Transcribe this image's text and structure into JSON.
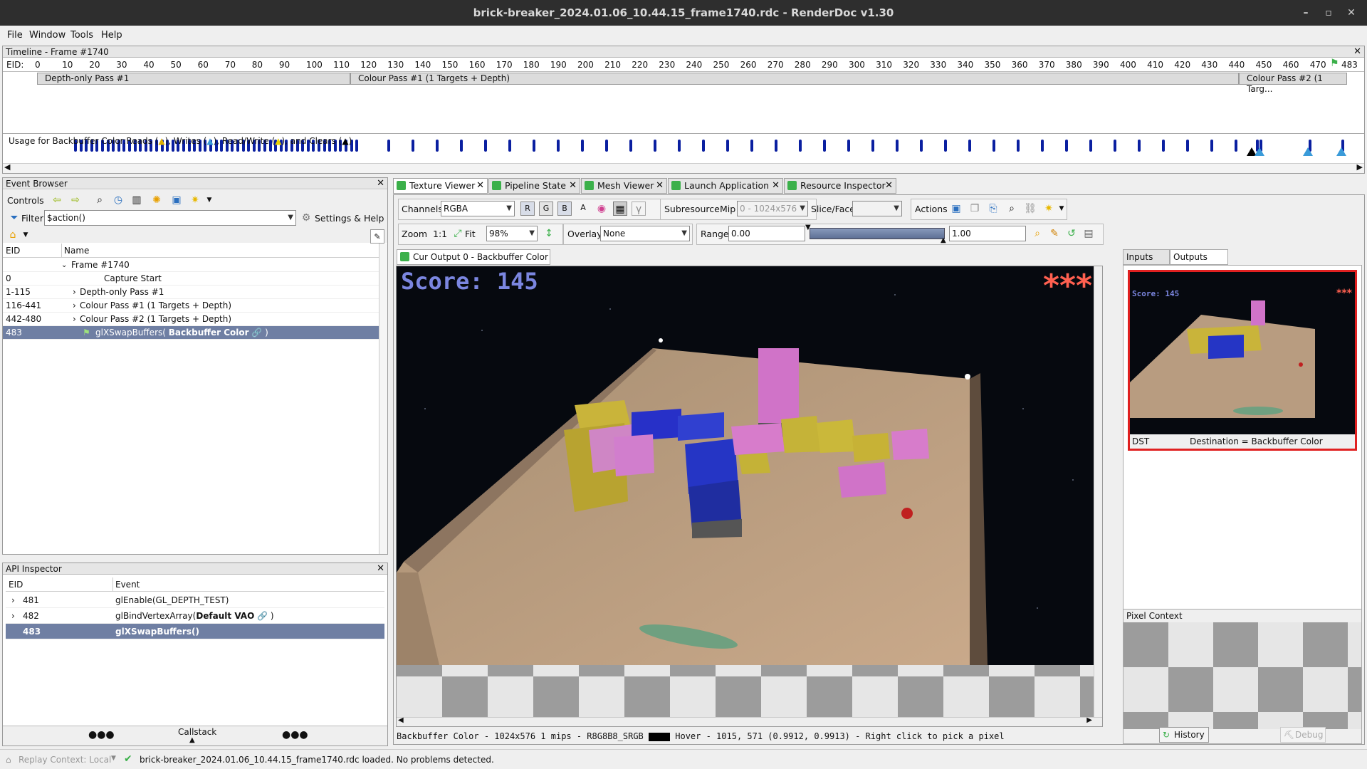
{
  "window": {
    "title": "brick-breaker_2024.01.06_10.44.15_frame1740.rdc - RenderDoc v1.30"
  },
  "menu": [
    "File",
    "Window",
    "Tools",
    "Help"
  ],
  "timeline": {
    "title": "Timeline - Frame #1740",
    "eid_label": "EID:",
    "ticks": [
      "0",
      "10",
      "20",
      "30",
      "40",
      "50",
      "60",
      "70",
      "80",
      "90",
      "100",
      "110",
      "120",
      "130",
      "140",
      "150",
      "160",
      "170",
      "180",
      "190",
      "200",
      "210",
      "220",
      "230",
      "240",
      "250",
      "260",
      "270",
      "280",
      "290",
      "300",
      "310",
      "320",
      "330",
      "340",
      "350",
      "360",
      "370",
      "380",
      "390",
      "400",
      "410",
      "420",
      "430",
      "440",
      "450",
      "460",
      "470"
    ],
    "current_eid": "483",
    "passes": [
      "Depth-only Pass #1",
      "Colour Pass #1 (1 Targets + Depth)",
      "Colour Pass #2 (1 Targ..."
    ],
    "usage_text": "Usage for Backbuffer Color:Reads (",
    "usage_writes": "), Writes (",
    "usage_rw": "), Read/Write (",
    "usage_clears": "), and Clears (",
    "usage_end": ")"
  },
  "event_browser": {
    "title": "Event Browser",
    "controls_label": "Controls",
    "filter_label": "Filter",
    "filter_value": "$action()",
    "settings_label": "Settings & Help",
    "col_eid": "EID",
    "col_name": "Name",
    "rows": [
      {
        "eid": "",
        "name": "Frame #1740"
      },
      {
        "eid": "0",
        "name": "Capture Start"
      },
      {
        "eid": "1-115",
        "name": "Depth-only Pass #1"
      },
      {
        "eid": "116-441",
        "name": "Colour Pass #1 (1 Targets + Depth)"
      },
      {
        "eid": "442-480",
        "name": "Colour Pass #2 (1 Targets + Depth)"
      },
      {
        "eid": "483",
        "name": "glXSwapBuffers(",
        "bold": "Backbuffer Color",
        "end": ")"
      }
    ]
  },
  "api_inspector": {
    "title": "API Inspector",
    "col_eid": "EID",
    "col_event": "Event",
    "rows": [
      {
        "eid": "481",
        "event": "glEnable(GL_DEPTH_TEST)"
      },
      {
        "eid": "482",
        "event": "glBindVertexArray(",
        "bold": "Default VAO",
        "end": ")"
      },
      {
        "eid": "483",
        "event": "glXSwapBuffers()"
      }
    ],
    "callstack": "Callstack"
  },
  "tabs": [
    "Texture Viewer",
    "Pipeline State",
    "Mesh Viewer",
    "Launch Application",
    "Resource Inspector"
  ],
  "toolbar": {
    "channels_label": "Channels",
    "channels_value": "RGBA",
    "r": "R",
    "g": "G",
    "b": "B",
    "a": "A",
    "subresource_label": "Subresource",
    "mip_label": "Mip",
    "mip_value": "0 - 1024x576",
    "slice_label": "Slice/Face",
    "actions_label": "Actions",
    "zoom_label": "Zoom",
    "zoom_1to1": "1:1",
    "fit_label": "Fit",
    "zoom_value": "98%",
    "overlay_label": "Overlay",
    "overlay_value": "None",
    "range_label": "Range",
    "range_min": "0.00",
    "range_max": "1.00"
  },
  "texture": {
    "tab_label": "Cur Output 0 - Backbuffer Color",
    "score": "Score: 145",
    "stars": "***",
    "status_line": "Backbuffer Color -  1024x576 1 mips -  R8G8B8_SRGB",
    "hover_line": "Hover -   1015,  571 (0.9912, 0.9913)  -  Right click to pick a pixel"
  },
  "side": {
    "inputs_tab": "Inputs",
    "outputs_tab": "Outputs",
    "thumb_score": "Score: 145",
    "thumb_stars": "***",
    "dst_label": "DST",
    "dst_value": "Destination = Backbuffer Color",
    "pixel_context": "Pixel Context",
    "history": "History",
    "debug": "Debug"
  },
  "statusbar": {
    "replay": "Replay Context: Local",
    "message": "brick-breaker_2024.01.06_10.44.15_frame1740.rdc loaded. No problems detected."
  },
  "colors": {
    "accent_selection": "#6f7fa3",
    "marker_blue": "#0a1fa0",
    "titlebar": "#2e2e2e"
  }
}
